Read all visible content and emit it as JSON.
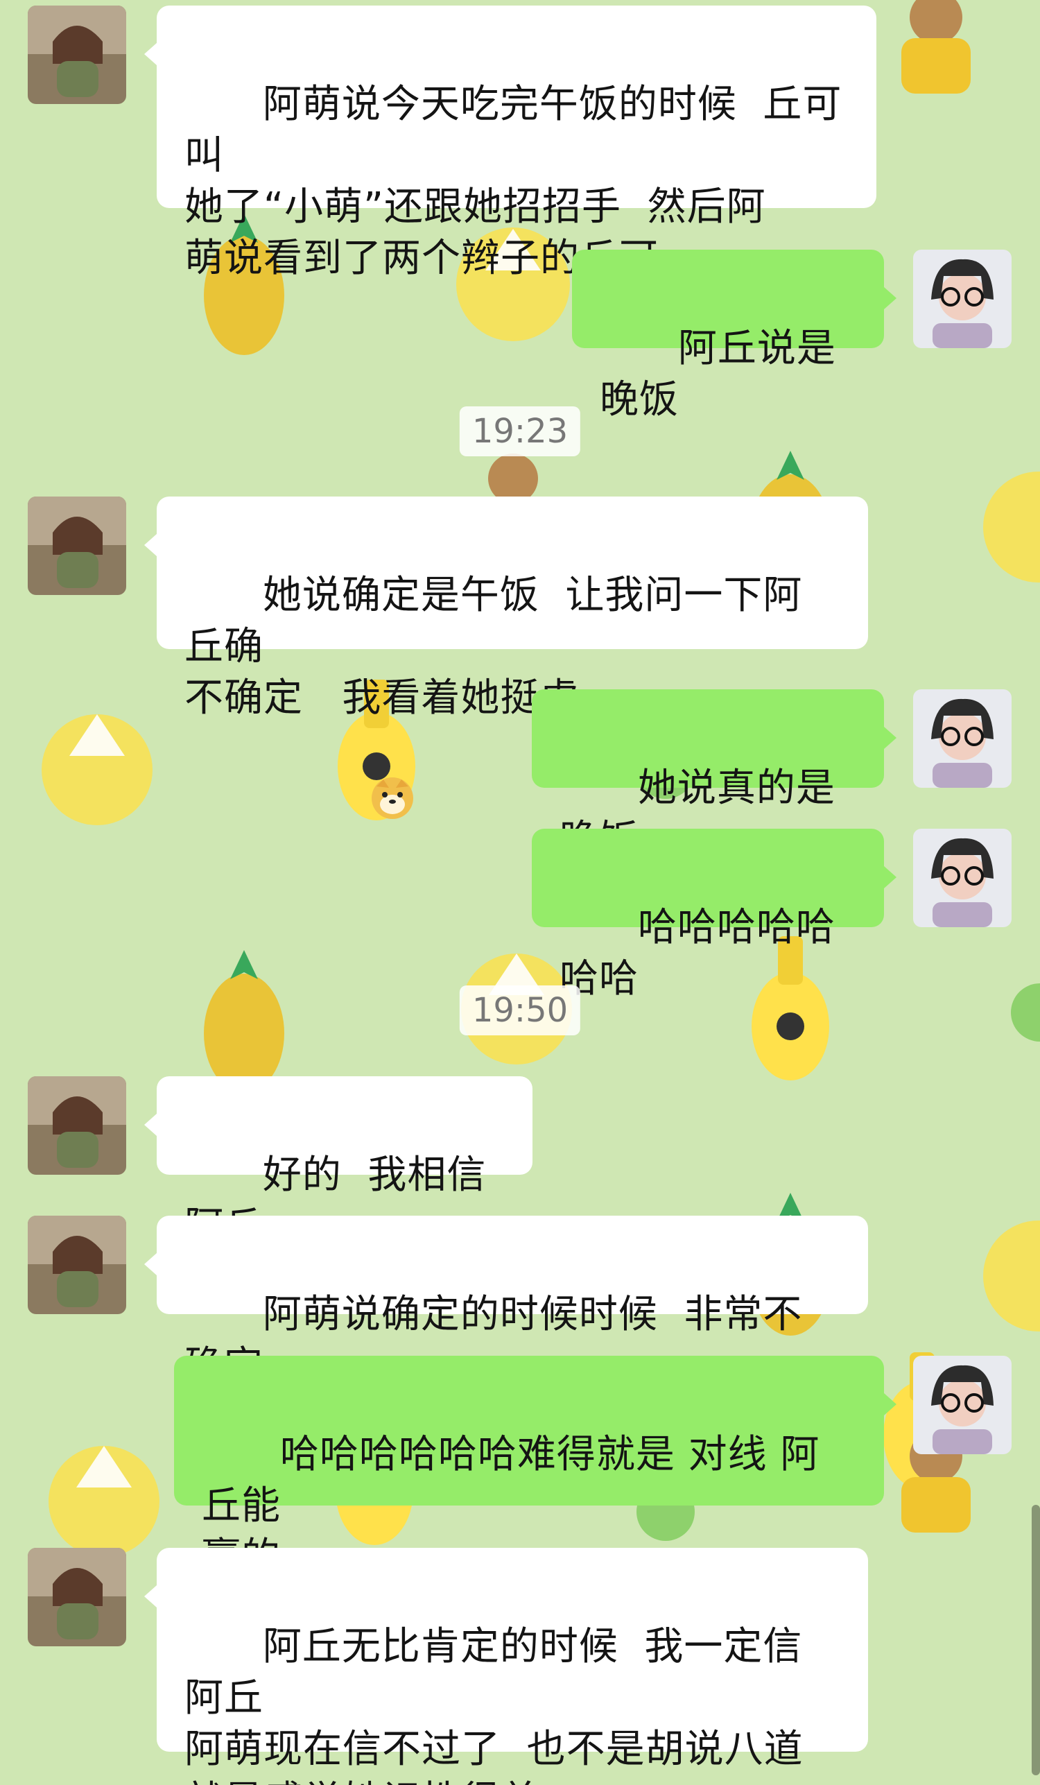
{
  "messages": [
    {
      "side": "left",
      "text": "阿萌说今天吃完午饭的时候  丘可叫\n她了“小萌”还跟她招招手  然后阿\n萌说看到了两个辫子的丘可"
    },
    {
      "side": "right",
      "text": "阿丘说是晚饭"
    },
    {
      "side": "left",
      "text": "她说确定是午饭  让我问一下阿丘确\n不确定   我看着她挺虚"
    },
    {
      "side": "right",
      "text": "她说真的是晚饭"
    },
    {
      "side": "right",
      "text": "哈哈哈哈哈哈哈"
    },
    {
      "side": "left",
      "text": "好的  我相信阿丘"
    },
    {
      "side": "left",
      "text": "阿萌说确定的时候时候  非常不确定"
    },
    {
      "side": "right",
      "text": "哈哈哈哈哈哈难得就是 对线 阿丘能\n赢的"
    },
    {
      "side": "left",
      "text": "阿丘无比肯定的时候  我一定信阿丘\n阿萌现在信不过了  也不是胡说八道\n就是感觉她记性很差"
    }
  ],
  "timestamps": [
    "19:23",
    "19:50"
  ],
  "emoji": {
    "name": "doge-emoji"
  },
  "colors": {
    "background": "#cfe7b3",
    "incoming_bubble": "#ffffff",
    "outgoing_bubble": "#95ec69",
    "text": "#141414",
    "timestamp_text": "#777777"
  },
  "avatars": {
    "left": "contact-avatar",
    "right": "user-avatar"
  }
}
